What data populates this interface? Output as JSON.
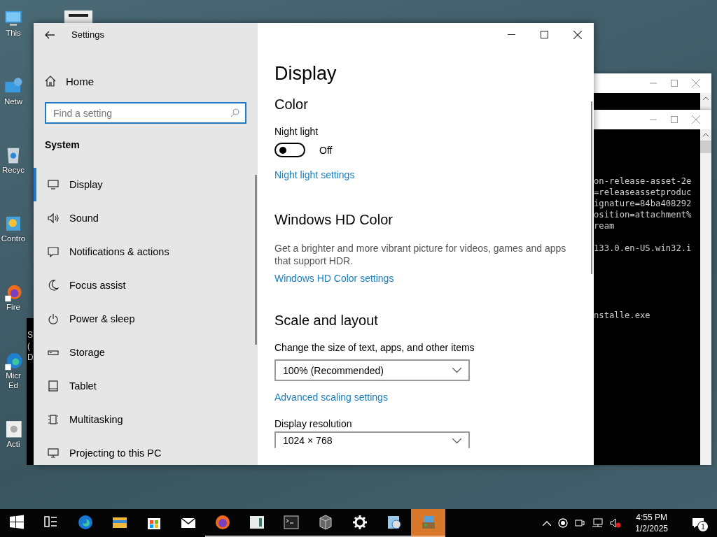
{
  "desktop_icons": [
    {
      "label": "This"
    },
    {
      "label": "Netw"
    },
    {
      "label": "Recyc"
    },
    {
      "label": "Contro"
    },
    {
      "label": "Fire"
    },
    {
      "label": "Micr Ed"
    },
    {
      "label": "Acti"
    }
  ],
  "background_window": {
    "lines": [
      "S",
      "(",
      "D"
    ]
  },
  "console_window": {
    "blocks": [
      [
        "on-release-asset-2e",
        "=releaseassetproduc",
        "ignature=84ba408292",
        "osition=attachment%",
        "ream"
      ],
      [
        "133.0.en-US.win32.i"
      ],
      [
        "nstalle.exe"
      ]
    ]
  },
  "settings": {
    "title": "Settings",
    "home": "Home",
    "search": {
      "placeholder": "Find a setting"
    },
    "section": "System",
    "nav_items": [
      {
        "label": "Display",
        "selected": true
      },
      {
        "label": "Sound",
        "selected": false
      },
      {
        "label": "Notifications & actions",
        "selected": false
      },
      {
        "label": "Focus assist",
        "selected": false
      },
      {
        "label": "Power & sleep",
        "selected": false
      },
      {
        "label": "Storage",
        "selected": false
      },
      {
        "label": "Tablet",
        "selected": false
      },
      {
        "label": "Multitasking",
        "selected": false
      },
      {
        "label": "Projecting to this PC",
        "selected": false
      }
    ],
    "page_title": "Display",
    "color": {
      "heading": "Color",
      "night_light": {
        "label": "Night light",
        "on": false,
        "state": "Off"
      },
      "link": "Night light settings"
    },
    "hd_color": {
      "heading": "Windows HD Color",
      "description": "Get a brighter and more vibrant picture for videos, games and apps that support HDR.",
      "link": "Windows HD Color settings"
    },
    "scale_layout": {
      "heading": "Scale and layout",
      "scale_label": "Change the size of text, apps, and other items",
      "scale_value": "100% (Recommended)",
      "link": "Advanced scaling settings",
      "resolution_label": "Display resolution",
      "resolution_value": "1024 × 768"
    }
  },
  "taskbar": {
    "apps": [
      {
        "running": false,
        "selected": false
      },
      {
        "running": false,
        "selected": false
      },
      {
        "running": false,
        "selected": false
      },
      {
        "running": false,
        "selected": false
      },
      {
        "running": true,
        "selected": false
      },
      {
        "running": true,
        "selected": false
      },
      {
        "running": true,
        "selected": false
      },
      {
        "running": true,
        "selected": false
      },
      {
        "running": true,
        "selected": false
      },
      {
        "running": true,
        "selected": false
      },
      {
        "running": true,
        "selected": true
      }
    ],
    "time": "4:55 PM",
    "date": "1/2/2025",
    "notification_count": "1"
  }
}
